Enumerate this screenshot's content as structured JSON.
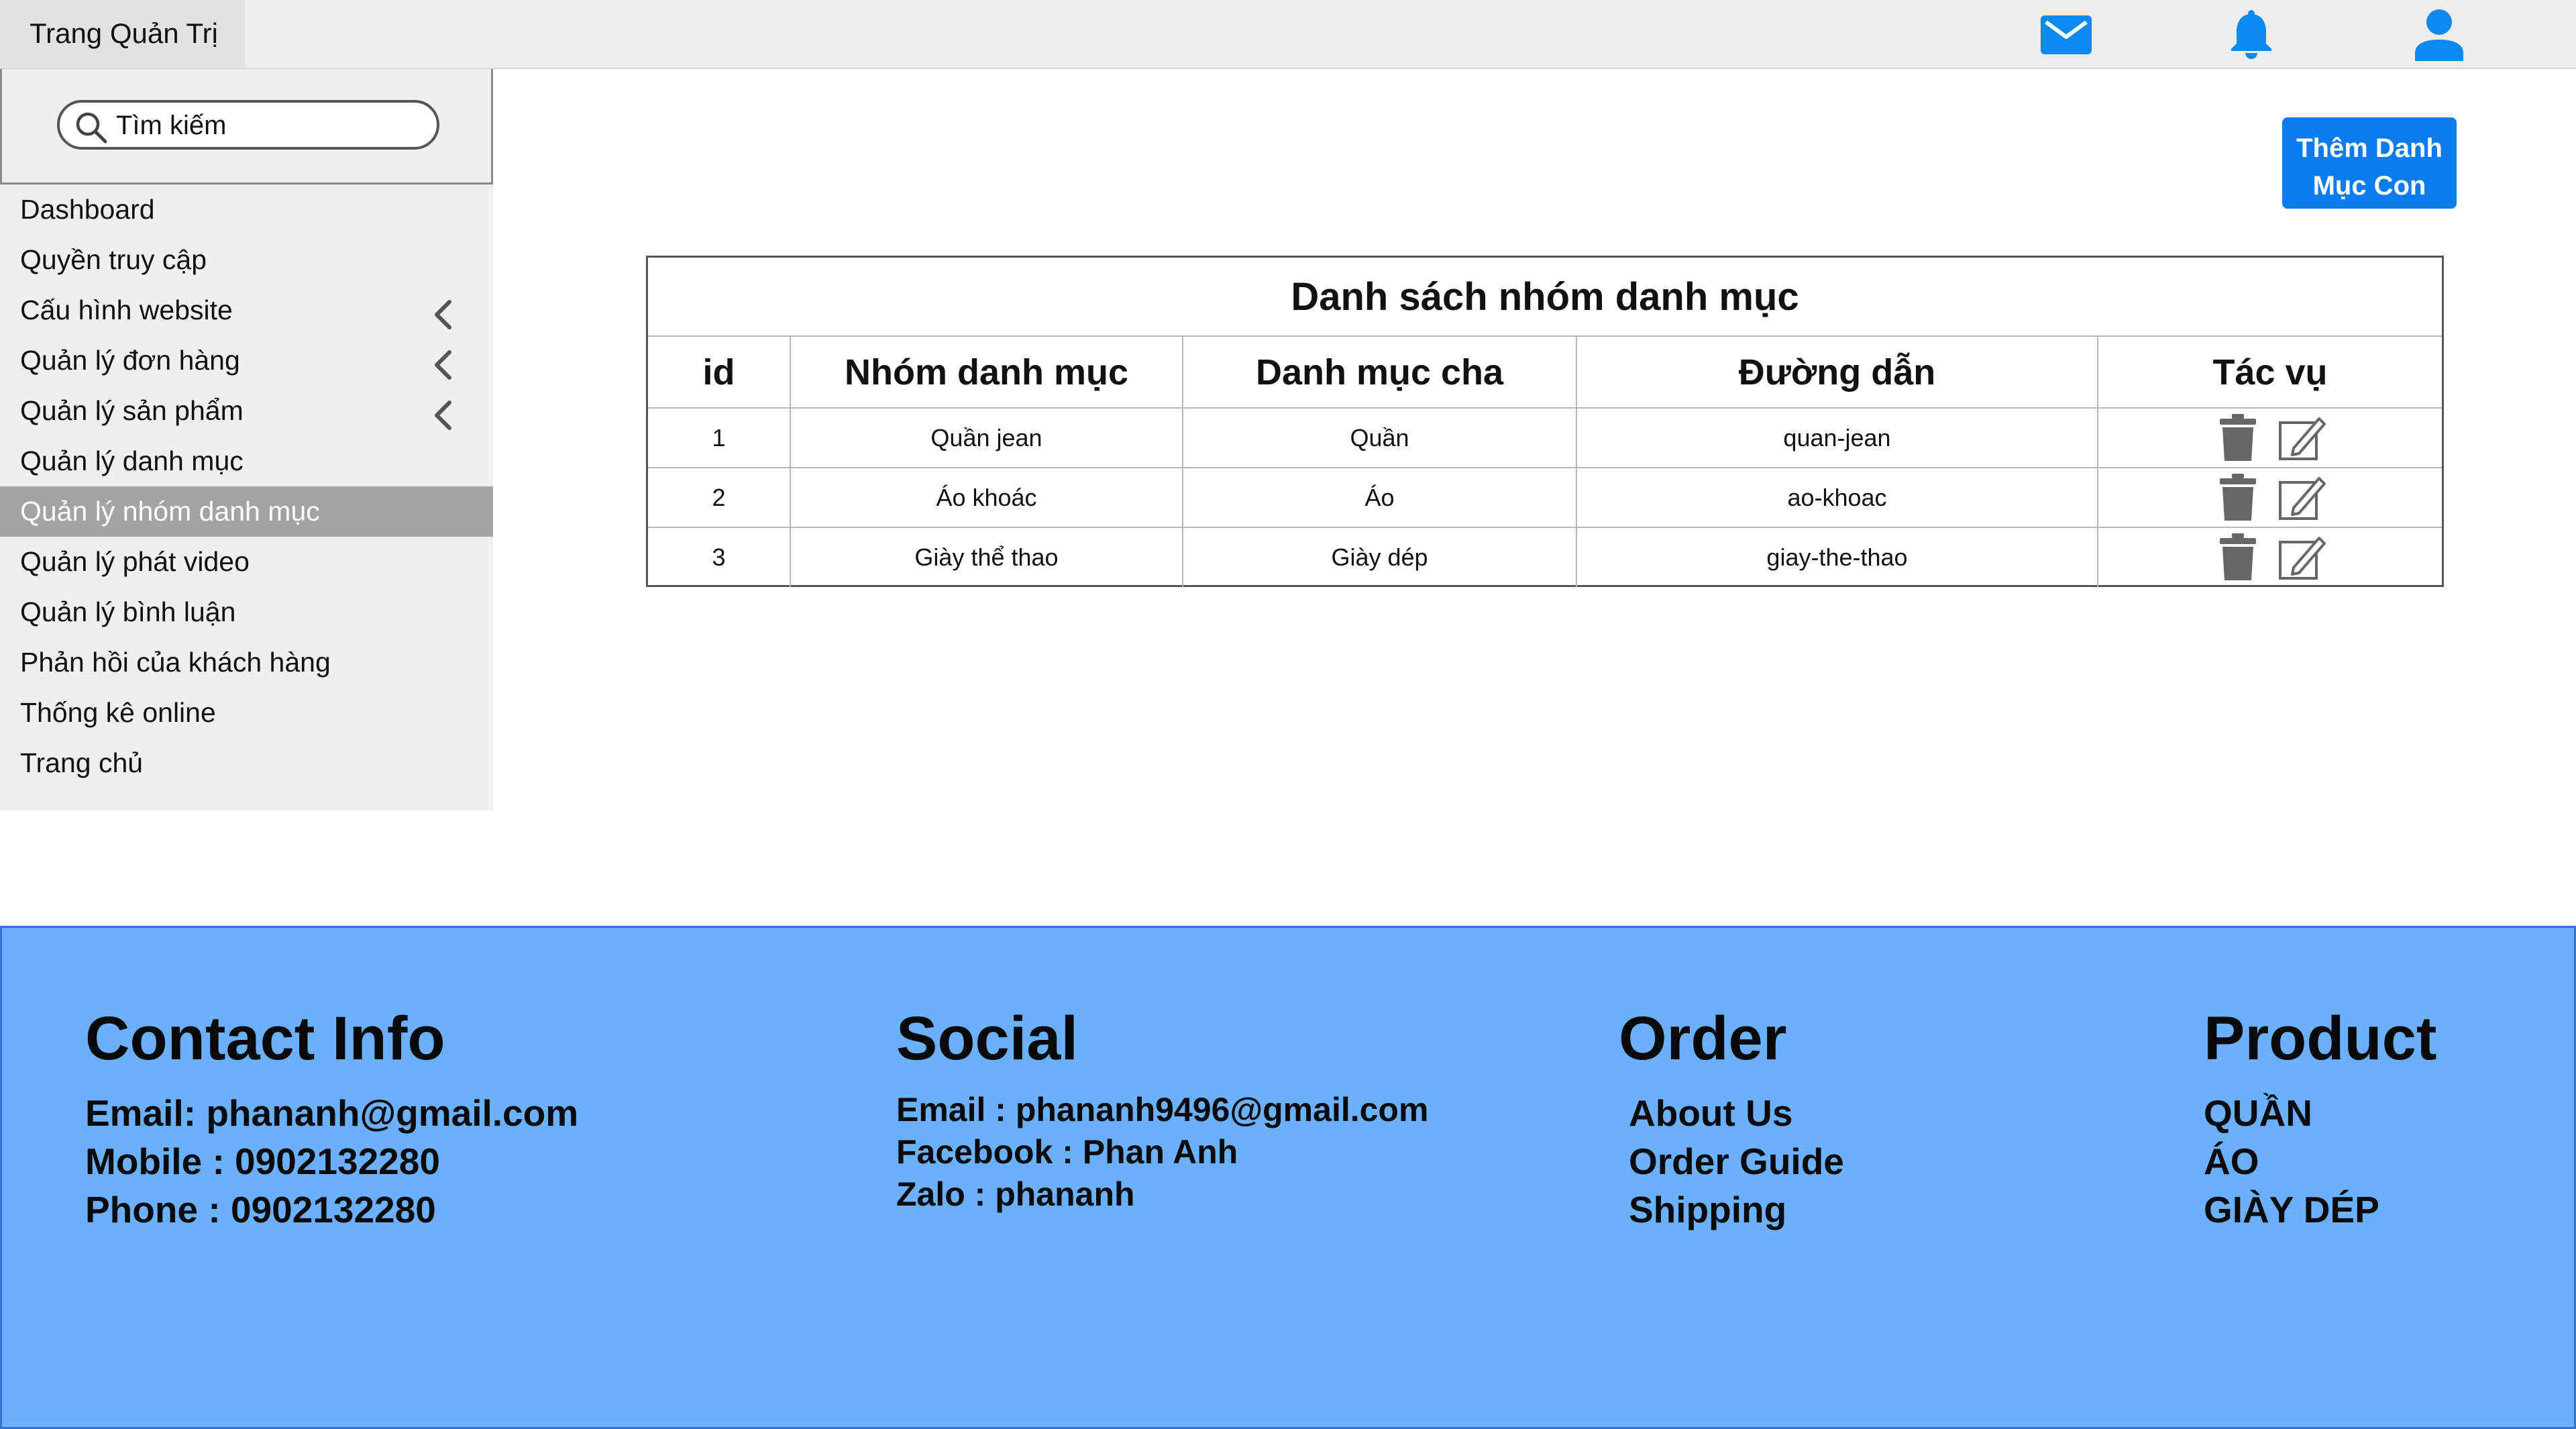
{
  "header": {
    "title": "Trang Quản Trị",
    "icons": [
      "mail-icon",
      "bell-icon",
      "user-icon"
    ],
    "icon_color": "#0a8af0"
  },
  "sidebar": {
    "search_placeholder": "Tìm kiếm",
    "items": [
      {
        "label": "Dashboard"
      },
      {
        "label": "Quyền truy cập"
      },
      {
        "label": "Cấu hình website"
      },
      {
        "label": "Quản lý đơn hàng"
      },
      {
        "label": "Quản lý sản phẩm"
      },
      {
        "label": "Quản lý danh mục"
      },
      {
        "label": "Quản lý nhóm danh mục"
      },
      {
        "label": "Quản lý phát video"
      },
      {
        "label": "Quản lý bình luận"
      },
      {
        "label": "Phản hồi của khách hàng"
      },
      {
        "label": "Thống kê online"
      },
      {
        "label": "Trang chủ"
      }
    ],
    "active_item": "Quản lý nhóm danh mục",
    "expandable_items": [
      "Cấu hình website",
      "Quản lý đơn hàng",
      "Quản lý sản phẩm"
    ]
  },
  "main": {
    "add_button_label": "Thêm Danh\nMục Con",
    "add_button_color": "#0a7cf0",
    "table": {
      "title": "Danh sách nhóm danh mục",
      "columns": [
        "id",
        "Nhóm danh mục",
        "Danh mục cha",
        "Đường dẫn",
        "Tác vụ"
      ],
      "rows": [
        {
          "id": "1",
          "group": "Quần jean",
          "parent": "Quần",
          "slug": "quan-jean"
        },
        {
          "id": "2",
          "group": "Áo khoác",
          "parent": "Áo",
          "slug": "ao-khoac"
        },
        {
          "id": "3",
          "group": "Giày thể thao",
          "parent": "Giày dép",
          "slug": "giay-the-thao"
        }
      ],
      "row_actions": [
        "trash-icon",
        "edit-icon"
      ]
    }
  },
  "footer": {
    "background": "#6ab0fa",
    "contact": {
      "heading": "Contact Info",
      "lines": [
        "Email: phananh@gmail.com",
        "Mobile : 0902132280",
        "Phone : 0902132280"
      ]
    },
    "social": {
      "heading": "Social",
      "lines": [
        "Email : phananh9496@gmail.com",
        "Facebook : Phan Anh",
        "Zalo : phananh"
      ]
    },
    "order": {
      "heading": "Order",
      "lines": [
        "About Us",
        "Order Guide",
        "Shipping"
      ]
    },
    "product": {
      "heading": "Product",
      "lines": [
        "QUẦN",
        "ÁO",
        "GIÀY DÉP"
      ]
    }
  }
}
